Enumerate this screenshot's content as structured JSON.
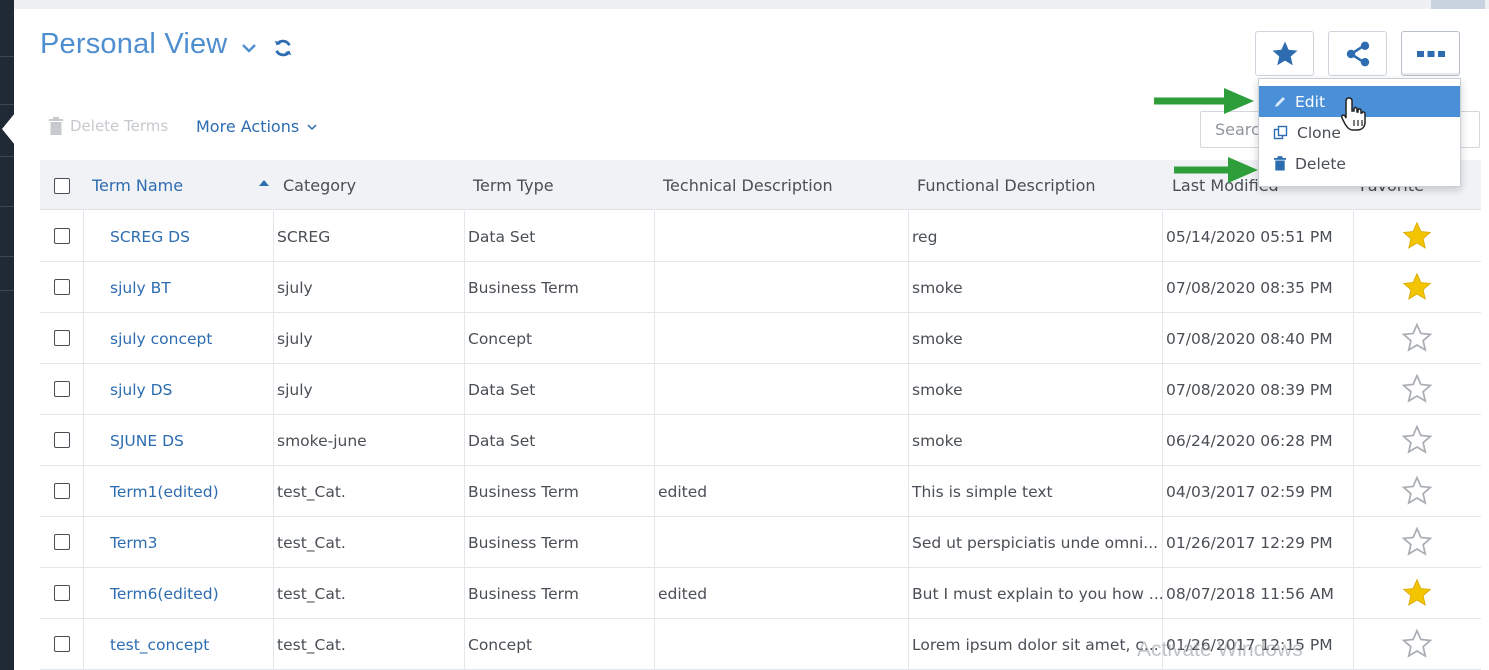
{
  "header": {
    "title": "Personal View",
    "favorites_icon": "star-icon",
    "share_icon": "share-icon",
    "more_icon": "ellipsis-icon"
  },
  "toolbar": {
    "delete_terms_label": "Delete Terms",
    "more_actions_label": "More Actions",
    "search_placeholder": "Search"
  },
  "dropdown": {
    "items": [
      {
        "label": "Edit",
        "icon": "pencil-icon"
      },
      {
        "label": "Clone",
        "icon": "clone-icon"
      },
      {
        "label": "Delete",
        "icon": "trash-icon"
      }
    ]
  },
  "table": {
    "columns": [
      "Term Name",
      "Category",
      "Term Type",
      "Technical Description",
      "Functional Description",
      "Last Modified",
      "Favorite"
    ],
    "rows": [
      {
        "name": "SCREG DS",
        "category": "SCREG",
        "type": "Data Set",
        "technical": "",
        "functional": "reg",
        "modified": "05/14/2020 05:51 PM",
        "favorite": true
      },
      {
        "name": "sjuly BT",
        "category": "sjuly",
        "type": "Business Term",
        "technical": "",
        "functional": "smoke",
        "modified": "07/08/2020 08:35 PM",
        "favorite": true
      },
      {
        "name": "sjuly concept",
        "category": "sjuly",
        "type": "Concept",
        "technical": "",
        "functional": "smoke",
        "modified": "07/08/2020 08:40 PM",
        "favorite": false
      },
      {
        "name": "sjuly DS",
        "category": "sjuly",
        "type": "Data Set",
        "technical": "",
        "functional": "smoke",
        "modified": "07/08/2020 08:39 PM",
        "favorite": false
      },
      {
        "name": "SJUNE DS",
        "category": "smoke-june",
        "type": "Data Set",
        "technical": "",
        "functional": "smoke",
        "modified": "06/24/2020 06:28 PM",
        "favorite": false
      },
      {
        "name": "Term1(edited)",
        "category": "test_Cat.",
        "type": "Business Term",
        "technical": "edited",
        "functional": "This is simple text",
        "modified": "04/03/2017 02:59 PM",
        "favorite": false
      },
      {
        "name": "Term3",
        "category": "test_Cat.",
        "type": "Business Term",
        "technical": "",
        "functional": "Sed ut perspiciatis unde omni...",
        "modified": "01/26/2017 12:29 PM",
        "favorite": false
      },
      {
        "name": "Term6(edited)",
        "category": "test_Cat.",
        "type": "Business Term",
        "technical": "edited",
        "functional": "But I must explain to you how ...",
        "modified": "08/07/2018 11:56 AM",
        "favorite": true
      },
      {
        "name": "test_concept",
        "category": "test_Cat.",
        "type": "Concept",
        "technical": "",
        "functional": "Lorem ipsum dolor sit amet, c...",
        "modified": "01/26/2017 12:15 PM",
        "favorite": false
      }
    ]
  },
  "watermark": "Activate Windows",
  "colors": {
    "accent": "#2d6cb0",
    "title": "#4f8fd0",
    "highlight": "#4a90d9",
    "star_filled": "#f2c500",
    "arrow": "#2e9e3a"
  }
}
